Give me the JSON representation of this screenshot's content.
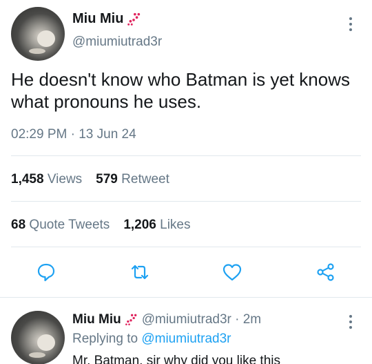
{
  "tweet": {
    "display_name": "Miu Miu",
    "handle": "@miumiutrad3r",
    "text": "He doesn't know who Batman is yet knows what pronouns he uses.",
    "timestamp": "02:29 PM · 13 Jun 24",
    "stats_row1": [
      {
        "num": "1,458",
        "label": "Views"
      },
      {
        "num": "579",
        "label": "Retweet"
      }
    ],
    "stats_row2": [
      {
        "num": "68",
        "label": "Quote Tweets"
      },
      {
        "num": "1,206",
        "label": "Likes"
      }
    ],
    "icons": [
      "paw-icon",
      "more-icon",
      "reply-icon",
      "retweet-icon",
      "like-icon",
      "share-icon"
    ]
  },
  "reply": {
    "display_name": "Miu Miu",
    "handle_time": "@miumiutrad3r · 2m",
    "replying_prefix": "Replying to",
    "replying_handle": "@miumiutrad3r",
    "text": "Mr. Batman, sir why did you like this"
  },
  "colors": {
    "primary_text": "#14171a",
    "secondary_text": "#657786",
    "link": "#1da1f2",
    "paw": "#e0245e",
    "divider": "#e1e8ed"
  }
}
